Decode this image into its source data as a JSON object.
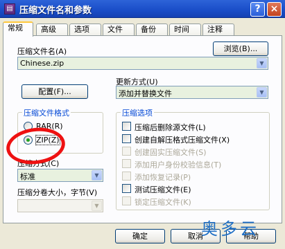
{
  "window": {
    "title": "压缩文件名和参数",
    "title_icon": "winrar-icon"
  },
  "title_buttons": {
    "help": "?",
    "close": "×"
  },
  "tabs": [
    "常规",
    "高级",
    "选项",
    "文件",
    "备份",
    "时间",
    "注释"
  ],
  "general": {
    "archive_name_label": "压缩文件名(A)",
    "browse_button": "浏览(B)...",
    "archive_name_value": "Chinese.zip",
    "update_mode_label": "更新方式(U)",
    "update_mode_value": "添加并替换文件",
    "profiles_button": "配置(F)...",
    "format_group_title": "压缩文件格式",
    "format_rar": "RAR(R)",
    "format_zip": "ZIP(Z)",
    "method_label": "压缩方式(C)",
    "method_value": "标准",
    "volume_label": "压缩分卷大小，字节(V)",
    "volume_value": ""
  },
  "options": {
    "group_title": "压缩选项",
    "items": [
      {
        "label": "压缩后删除源文件(L)",
        "checked": false,
        "enabled": true
      },
      {
        "label": "创建自解压格式压缩文件(X)",
        "checked": false,
        "enabled": true
      },
      {
        "label": "创建固实压缩文件(S)",
        "checked": false,
        "enabled": false
      },
      {
        "label": "添加用户身份校验信息(T)",
        "checked": false,
        "enabled": false
      },
      {
        "label": "添加恢复记录(P)",
        "checked": false,
        "enabled": false
      },
      {
        "label": "测试压缩文件(E)",
        "checked": false,
        "enabled": true
      },
      {
        "label": "锁定压缩文件(K)",
        "checked": false,
        "enabled": false
      }
    ]
  },
  "footer": {
    "ok": "确定",
    "cancel": "取消",
    "help": "帮助"
  },
  "watermark": "奥多云",
  "colors": {
    "title_bar": "#2d63d8",
    "dialog_bg": "#ece9d8",
    "annotation": "#ee1111",
    "watermark": "#1f6fc5"
  }
}
